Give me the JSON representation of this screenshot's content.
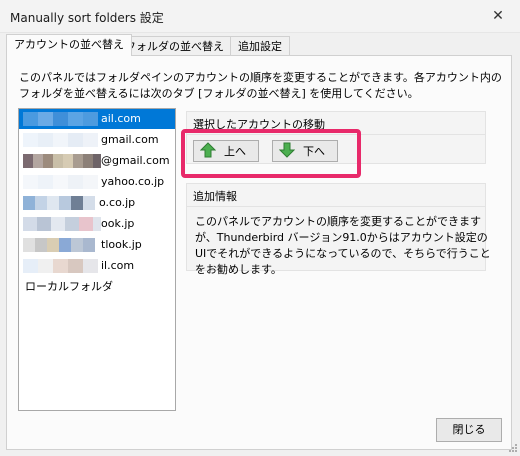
{
  "window": {
    "title": "Manually sort folders 設定",
    "close_glyph": "✕"
  },
  "tabs": [
    {
      "label": "アカウントの並べ替え",
      "active": true
    },
    {
      "label": "フォルダの並べ替え",
      "active": false
    },
    {
      "label": "追加設定",
      "active": false
    }
  ],
  "description": "このパネルではフォルダペインのアカウントの順序を変更することができます。各アカウント内のフォルダを並べ替えるには次のタブ [フォルダの並べ替え] を使用してください。",
  "accounts": [
    {
      "label": "ail.com",
      "selected": true
    },
    {
      "label": "gmail.com",
      "selected": false
    },
    {
      "label": "@gmail.com",
      "selected": false
    },
    {
      "label": "yahoo.co.jp",
      "selected": false
    },
    {
      "label": "o.co.jp",
      "selected": false
    },
    {
      "label": "ook.jp",
      "selected": false
    },
    {
      "label": "tlook.jp",
      "selected": false
    },
    {
      "label": "il.com",
      "selected": false
    },
    {
      "label": "ローカルフォルダ",
      "selected": false
    }
  ],
  "move_group": {
    "header": "選択したアカウントの移動",
    "up_label": "上へ",
    "down_label": "下へ",
    "up_icon": "arrow-up-icon",
    "down_icon": "arrow-down-icon"
  },
  "info_group": {
    "header": "追加情報",
    "text": "このパネルでアカウントの順序を変更することができますが、Thunderbird バージョン91.0からはアカウント設定のUIでそれができるようになっているので、そちらで行うことをお勧めします。"
  },
  "close_button": "閉じる",
  "colors": {
    "selection": "#0078d7",
    "highlight": "#e8296a",
    "arrow_green": "#4caf50"
  }
}
